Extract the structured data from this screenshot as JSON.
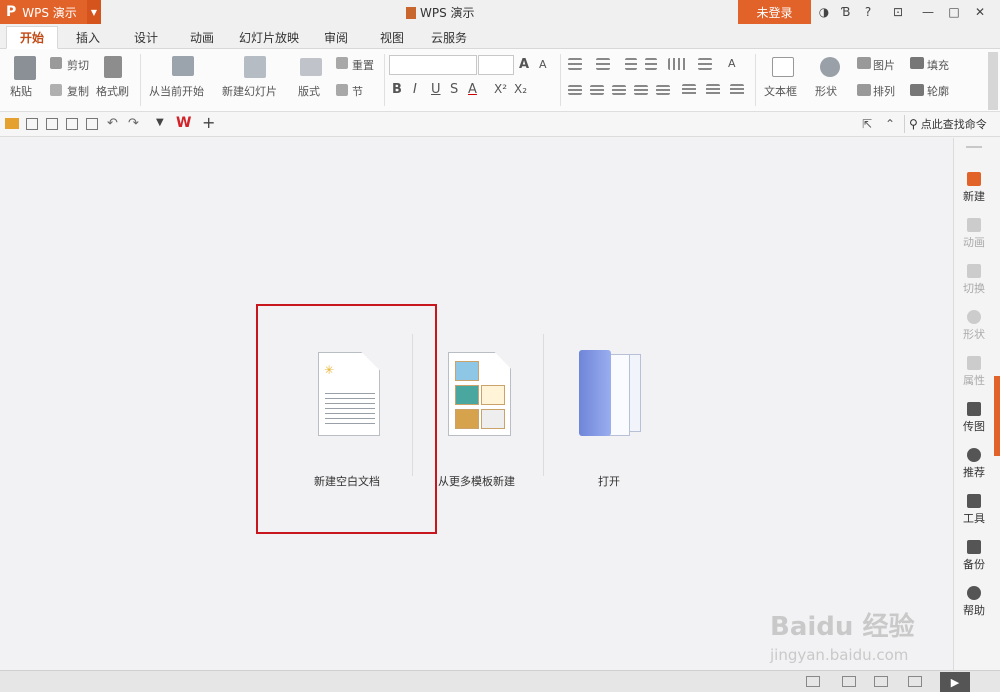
{
  "app": {
    "logo": "P",
    "name": "WPS 演示",
    "window_title": "WPS 演示",
    "login": "未登录"
  },
  "window_buttons": [
    "?",
    "—",
    "□",
    "✕"
  ],
  "tabs": [
    {
      "label": "开始",
      "active": true
    },
    {
      "label": "插入"
    },
    {
      "label": "设计"
    },
    {
      "label": "动画"
    },
    {
      "label": "幻灯片放映"
    },
    {
      "label": "审阅"
    },
    {
      "label": "视图"
    },
    {
      "label": "云服务"
    }
  ],
  "ribbon": {
    "paste": "粘贴",
    "cut": "剪切",
    "copy": "复制",
    "format_painter": "格式刷",
    "from_current": "从当前开始",
    "new_slide": "新建幻灯片",
    "layout": "版式",
    "reset": "重置",
    "section": "节",
    "font_buttons": [
      "B",
      "I",
      "U",
      "S",
      "A",
      "X²",
      "X₂"
    ],
    "textbox": "文本框",
    "shape": "形状",
    "picture": "图片",
    "arrange": "排列",
    "fill": "填充",
    "outline": "轮廓"
  },
  "qat": {
    "find_command": "点此查找命令"
  },
  "start_page": {
    "items": [
      {
        "label": "新建空白文档"
      },
      {
        "label": "从更多模板新建"
      },
      {
        "label": "打开"
      }
    ]
  },
  "right_panel": [
    {
      "label": "新建",
      "icon": "new-doc-icon"
    },
    {
      "label": "动画",
      "icon": "animation-icon"
    },
    {
      "label": "切换",
      "icon": "transition-icon"
    },
    {
      "label": "形状",
      "icon": "shape-icon"
    },
    {
      "label": "属性",
      "icon": "property-icon"
    },
    {
      "label": "传图",
      "icon": "upload-image-icon"
    },
    {
      "label": "推荐",
      "icon": "recommend-icon"
    },
    {
      "label": "工具",
      "icon": "tools-icon"
    },
    {
      "label": "备份",
      "icon": "backup-icon"
    },
    {
      "label": "帮助",
      "icon": "help-icon"
    }
  ],
  "watermark": {
    "brand": "Baidu 经验",
    "url": "jingyan.baidu.com"
  },
  "colors": {
    "accent": "#e2632a",
    "highlight": "#c8161d"
  }
}
